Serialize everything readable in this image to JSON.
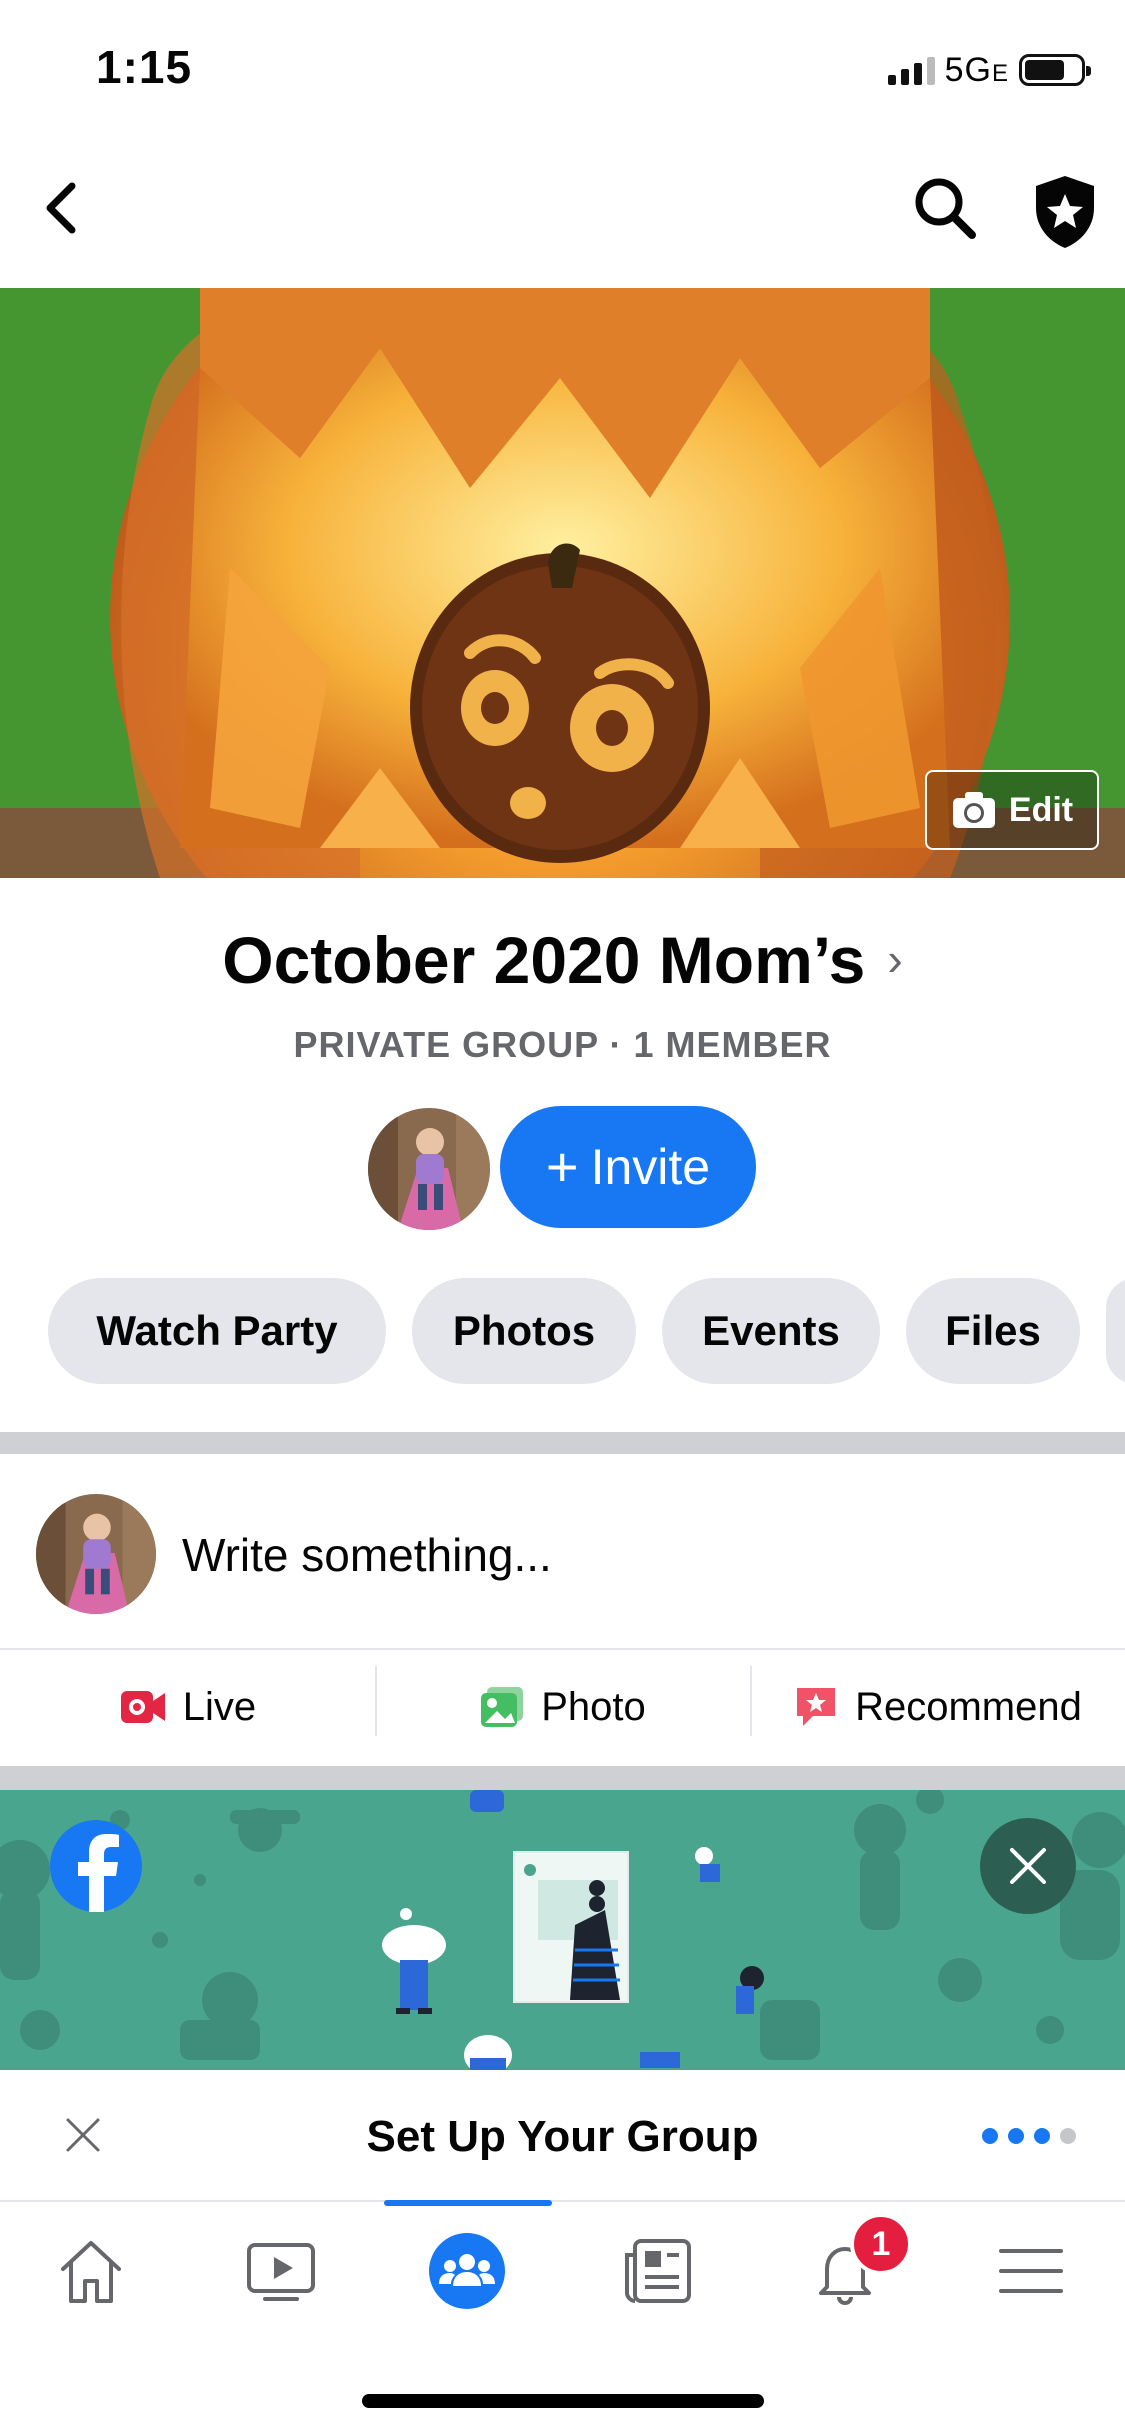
{
  "status": {
    "time": "1:15",
    "network": "5G",
    "network_suffix": "E"
  },
  "header": {
    "back_icon": "chevron-left-icon",
    "search_icon": "search-icon",
    "admin_icon": "shield-star-icon"
  },
  "cover": {
    "edit_label": "Edit",
    "edit_icon": "camera-icon"
  },
  "group": {
    "name": "October 2020 Mom’s",
    "subtitle": "PRIVATE GROUP · 1 MEMBER",
    "invite_label": "Invite"
  },
  "chips": [
    "Watch Party",
    "Photos",
    "Events",
    "Files"
  ],
  "composer": {
    "placeholder": "Write something..."
  },
  "actions": [
    {
      "label": "Live",
      "icon": "live-video-icon",
      "color": "#e42645"
    },
    {
      "label": "Photo",
      "icon": "photo-icon",
      "color": "#45bd62"
    },
    {
      "label": "Recommend",
      "icon": "recommend-icon",
      "color": "#f25268"
    }
  ],
  "setup": {
    "title": "Set Up Your Group",
    "steps_total": 4,
    "steps_done": 3
  },
  "tabbar": {
    "tabs": [
      "home-icon",
      "watch-icon",
      "groups-icon",
      "news-icon",
      "notifications-icon",
      "menu-icon"
    ],
    "active": "groups-icon",
    "notification_badge": "1"
  },
  "colors": {
    "accent": "#1877f2",
    "promo_bg": "#4aa58f",
    "chip_bg": "#e4e6eb",
    "badge": "#e41e3f"
  }
}
